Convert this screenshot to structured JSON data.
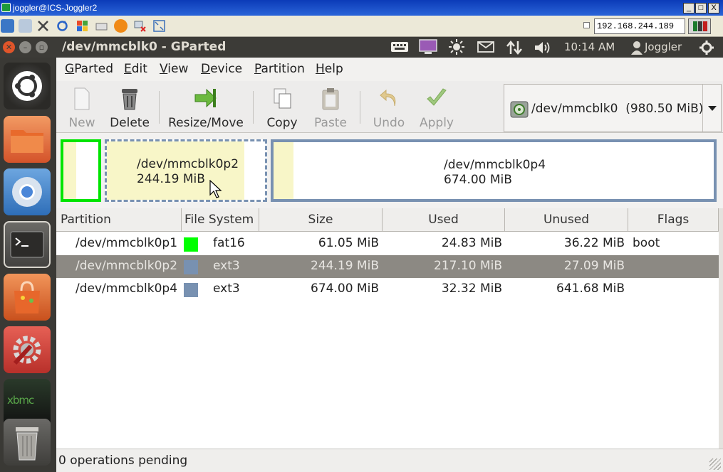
{
  "vnc": {
    "window_title": "joggler@ICS-Joggler2",
    "minimize": "_",
    "maximize": "□",
    "close": "X",
    "host": "192.168.244.189"
  },
  "panel": {
    "window_title": "/dev/mmcblk0 - GParted",
    "clock": "10:14 AM",
    "user": "Joggler"
  },
  "launcher": {
    "items": [
      "dash-home",
      "files",
      "chromium",
      "terminal",
      "software-center",
      "system-settings",
      "xbmc",
      "trash"
    ],
    "xbmc_label": "xbmc"
  },
  "menubar": {
    "items": [
      {
        "first": "G",
        "rest": "Parted"
      },
      {
        "first": "E",
        "rest": "dit"
      },
      {
        "first": "V",
        "rest": "iew"
      },
      {
        "first": "D",
        "rest": "evice"
      },
      {
        "first": "P",
        "rest": "artition"
      },
      {
        "first": "H",
        "rest": "elp"
      }
    ]
  },
  "toolbar": {
    "new": "New",
    "delete": "Delete",
    "resize_move": "Resize/Move",
    "copy": "Copy",
    "paste": "Paste",
    "undo": "Undo",
    "apply": "Apply",
    "device": "/dev/mmcblk0  (980.50 MiB)"
  },
  "map": {
    "p2": {
      "name": "/dev/mmcblk0p2",
      "size": "244.19 MiB"
    },
    "p4": {
      "name": "/dev/mmcblk0p4",
      "size": "674.00 MiB"
    }
  },
  "table": {
    "headers": [
      "Partition",
      "File System",
      "Size",
      "Used",
      "Unused",
      "Flags"
    ],
    "rows": [
      {
        "partition": "/dev/mmcblk0p1",
        "fs": "fat16",
        "size": "61.05 MiB",
        "used": "24.83 MiB",
        "unused": "36.22 MiB",
        "flags": "boot",
        "color": "#00ff00"
      },
      {
        "partition": "/dev/mmcblk0p2",
        "fs": "ext3",
        "size": "244.19 MiB",
        "used": "217.10 MiB",
        "unused": "27.09 MiB",
        "flags": "",
        "color": "#7891b1"
      },
      {
        "partition": "/dev/mmcblk0p4",
        "fs": "ext3",
        "size": "674.00 MiB",
        "used": "32.32 MiB",
        "unused": "641.68 MiB",
        "flags": "",
        "color": "#7891b1"
      }
    ]
  },
  "status": "0 operations pending",
  "colors": {
    "fat16": "#00ff00",
    "ext3": "#7891b1",
    "selected_row": "#8c8983",
    "ubuntu_close": "#e0552a"
  }
}
